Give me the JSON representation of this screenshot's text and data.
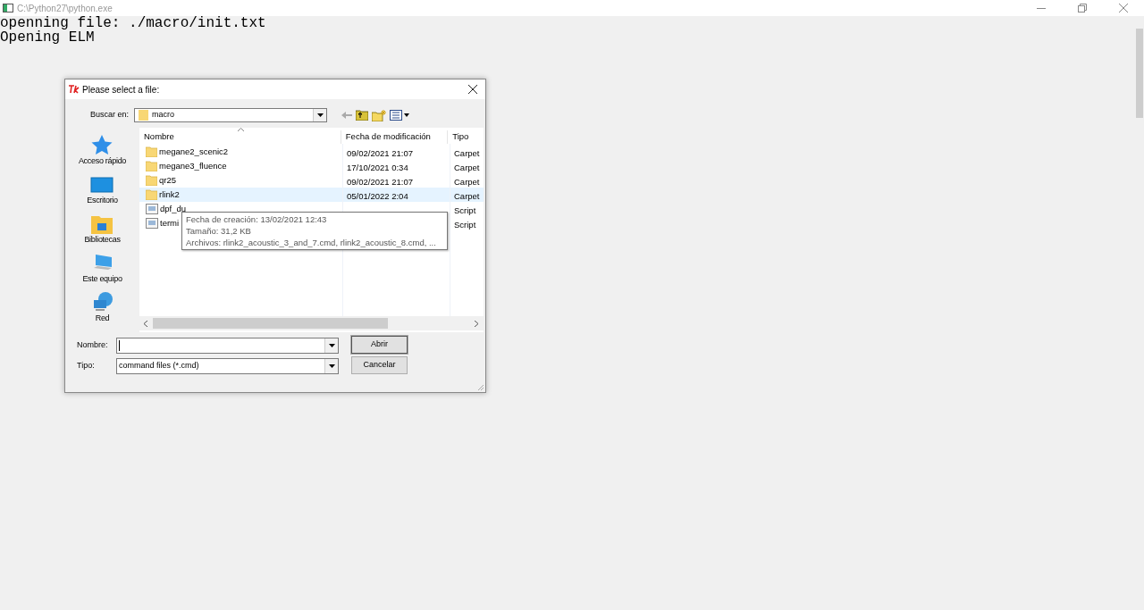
{
  "console": {
    "title": "C:\\Python27\\python.exe",
    "lines": [
      "openning file: ./macro/init.txt",
      "Opening ELM"
    ]
  },
  "dialog": {
    "title": "Please select a file:",
    "look_in_label": "Buscar en:",
    "look_in_value": "macro",
    "places": [
      {
        "label": "Acceso rápido"
      },
      {
        "label": "Escritorio"
      },
      {
        "label": "Bibliotecas"
      },
      {
        "label": "Este equipo"
      },
      {
        "label": "Red"
      }
    ],
    "columns": [
      "Nombre",
      "Fecha de modificación",
      "Tipo"
    ],
    "rows": [
      {
        "kind": "folder",
        "name": "megane2_scenic2",
        "date": "09/02/2021 21:07",
        "type": "Carpet",
        "selected": false
      },
      {
        "kind": "folder",
        "name": "megane3_fluence",
        "date": "17/10/2021 0:34",
        "type": "Carpet",
        "selected": false
      },
      {
        "kind": "folder",
        "name": "qr25",
        "date": "09/02/2021 21:07",
        "type": "Carpet",
        "selected": false
      },
      {
        "kind": "folder",
        "name": "rlink2",
        "date": "05/01/2022 2:04",
        "type": "Carpet",
        "selected": true
      },
      {
        "kind": "script",
        "name": "dpf_du",
        "type": "Script",
        "selected": false
      },
      {
        "kind": "script",
        "name": "termi",
        "type": "Script",
        "selected": false
      }
    ],
    "tooltip": {
      "lines": [
        "Fecha de creación: 13/02/2021 12:43",
        "Tamaño: 31,2 KB",
        "Archivos: rlink2_acoustic_3_and_7.cmd, rlink2_acoustic_8.cmd, ..."
      ]
    },
    "filename_label": "Nombre:",
    "type_label": "Tipo:",
    "type_value": "command files (*.cmd)",
    "buttons": [
      "Abrir",
      "Cancelar"
    ]
  }
}
